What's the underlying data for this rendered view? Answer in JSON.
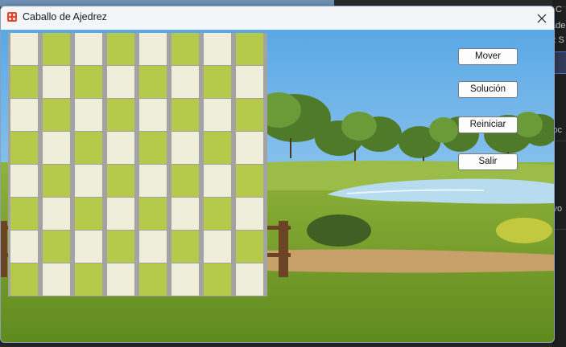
{
  "window": {
    "title": "Caballo de Ajedrez",
    "icon": "dice-icon",
    "close_icon": "close-icon"
  },
  "board": {
    "rows": 8,
    "cols": 8,
    "light_color": "#eeeedb",
    "dark_color": "#b5c94a",
    "separator_color": "#a3a3a3"
  },
  "buttons": {
    "mover": "Mover",
    "solucion": "Solución",
    "reiniciar": "Reiniciar",
    "salir": "Salir"
  },
  "background_fragments": {
    "right_texts": [
      "C",
      "ade",
      "z S",
      "loc",
      "ivo"
    ]
  }
}
